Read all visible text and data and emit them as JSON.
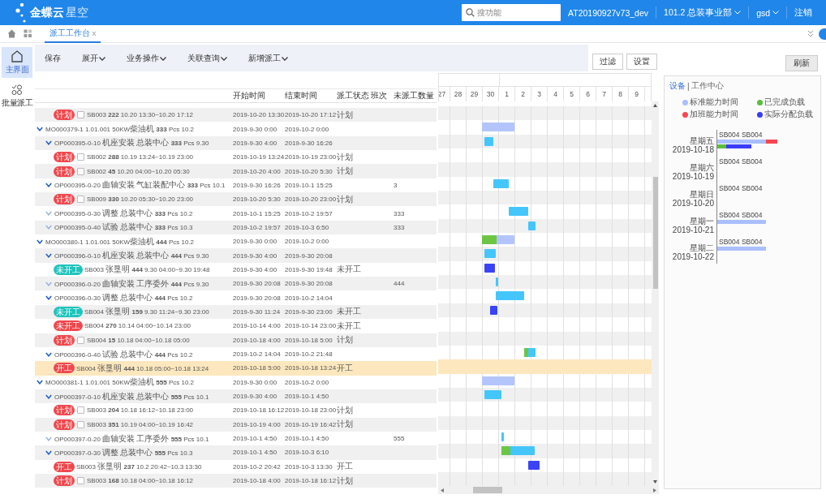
{
  "topbar": {
    "logo": {
      "name": "金蝶云",
      "product": "星空"
    },
    "search": {
      "placeholder": "搜功能"
    },
    "account": "AT20190927v73_dev",
    "org": "101.2 总装事业部",
    "user": "gsd",
    "logout": "注销"
  },
  "tabs": [
    {
      "label": "派工工作台",
      "close": "x",
      "selected": true
    }
  ],
  "sidebar": {
    "items": [
      {
        "kind": "home",
        "label": "主界面",
        "selected": true
      },
      {
        "kind": "batch",
        "label": "批量派工",
        "selected": false
      }
    ]
  },
  "toolbar": [
    {
      "label": "保存",
      "dropdown": false
    },
    {
      "label": "展开",
      "dropdown": true
    },
    {
      "label": "业务操作",
      "dropdown": true
    },
    {
      "label": "关联查询",
      "dropdown": true
    },
    {
      "label": "新增派工",
      "dropdown": true
    }
  ],
  "gantt_buttons": [
    "过滤",
    "设置"
  ],
  "refresh": "刷新",
  "table": {
    "columns": [
      "开始时间",
      "结束时间",
      "派工状态",
      "班次",
      "未派工数量"
    ],
    "rows": [
      {
        "kind": "task",
        "badge": {
          "text": "计划",
          "color": "#f0474d"
        },
        "checked": false,
        "text": "SB003 **222** 10.20 13:30~10.20 17:12",
        "start": "2019-10-20 13:30",
        "end": "2019-10-20 17:12",
        "status": "计划",
        "selected": false
      },
      {
        "kind": "mo",
        "expanded": true,
        "text": "MO000379-1 1.01.001 50KW柴油机 **333** Pcs 10.2",
        "start": "2019-9-30 0:00",
        "end": "2019-10-2 0:00",
        "selected": false,
        "children": [
          {
            "kind": "op",
            "expanded": true,
            "text": "OP000395-0-10 机座安装 总装中心 **333** Pcs 9.30",
            "start": "2019-9-30 4:00",
            "end": "2019-9-30 16:26",
            "selected": false,
            "children": [
              {
                "kind": "task",
                "badge": {
                  "text": "计划",
                  "color": "#f0474d"
                },
                "checked": false,
                "text": "SB002 **288** 10.19 13:24~10.19 23:00",
                "start": "2019-10-19 13:24",
                "end": "2019-10-19 23:00",
                "status": "计划",
                "selected": false
              },
              {
                "kind": "task",
                "badge": {
                  "text": "计划",
                  "color": "#f0474d"
                },
                "checked": false,
                "text": "SB002 **45** 10.20 04:00~10.20 05:30",
                "start": "2019-10-20 4:00",
                "end": "2019-10-20 5:30",
                "status": "计划",
                "selected": false
              }
            ]
          },
          {
            "kind": "op",
            "expanded": true,
            "text": "OP000395-0-20 曲轴安装 气缸装配中心 **333** Pcs 10.1",
            "start": "2019-9-30 16:26",
            "end": "2019-10-1 15:25",
            "unassigned": "3",
            "selected": false,
            "children": [
              {
                "kind": "task",
                "badge": {
                  "text": "计划",
                  "color": "#f0474d"
                },
                "checked": false,
                "text": "SB009 **330** 10.20 05:30~10.20 23:00",
                "start": "2019-10-20 5:30",
                "end": "2019-10-20 23:00",
                "status": "计划",
                "selected": false
              }
            ]
          },
          {
            "kind": "op",
            "expanded": false,
            "text": "OP000395-0-30 调整 总装中心 **333** Pcs 10.2",
            "start": "2019-10-1 15:25",
            "end": "2019-10-2 19:57",
            "unassigned": "333",
            "selected": false
          },
          {
            "kind": "op",
            "expanded": false,
            "text": "OP000395-0-40 试验 总装中心 **333** Pcs 10.3",
            "start": "2019-10-2 19:57",
            "end": "2019-10-3 6:50",
            "unassigned": "333",
            "selected": false
          }
        ]
      },
      {
        "kind": "mo",
        "expanded": true,
        "text": "MO000380-1 1.01.001 50KW柴油机 **444** Pcs 10.2",
        "start": "2019-9-30 0:00",
        "end": "2019-10-2 0:00",
        "level": 0.46,
        "selected": false,
        "children": [
          {
            "kind": "op",
            "expanded": true,
            "text": "OP000396-0-10 机座安装 总装中心 **444** Pcs 9.30",
            "start": "2019-9-30 4:00",
            "end": "2019-9-30 20:08",
            "selected": false,
            "children": [
              {
                "kind": "task",
                "badge": {
                  "text": "未开工",
                  "color": "#1fc3bc"
                },
                "text": "SB003 张垦明 **444** 9.30 04:00~9.30 19:48",
                "start": "2019-9-30 4:00",
                "end": "2019-9-30 19:48",
                "status": "未开工",
                "selected": false
              }
            ]
          },
          {
            "kind": "op",
            "expanded": false,
            "text": "OP000396-0-20 曲轴安装 工序委外 **444** Pcs 9.30",
            "start": "2019-9-30 20:08",
            "end": "2019-9-30 20:08",
            "unassigned": "444",
            "selected": false
          },
          {
            "kind": "op",
            "expanded": true,
            "text": "OP000396-0-30 调整 总装中心 **444** Pcs 10.2",
            "start": "2019-9-30 20:08",
            "end": "2019-10-2 14:04",
            "selected": false,
            "children": [
              {
                "kind": "task",
                "badge": {
                  "text": "未开工",
                  "color": "#1fc3bc"
                },
                "text": "SB004 张垦明 **159** 9.30 11:24~9.30 23:00",
                "start": "2019-9-30 11:24",
                "end": "2019-9-30 23:00",
                "status": "未开工",
                "selected": false
              },
              {
                "kind": "task",
                "badge": {
                  "text": "未开工",
                  "color": "#f0474d"
                },
                "text": "SB004 **270** 10.14 04:00~10.14 23:00",
                "start": "2019-10-14 4:00",
                "end": "2019-10-14 23:00",
                "status": "未开工",
                "selected": false
              },
              {
                "kind": "task",
                "badge": {
                  "text": "计划",
                  "color": "#f0474d"
                },
                "checked": false,
                "text": "SB004 **15** 10.18 04:00~10.18 05:00",
                "start": "2019-10-18 4:00",
                "end": "2019-10-18 5:00",
                "status": "计划",
                "selected": false
              }
            ]
          },
          {
            "kind": "op",
            "expanded": true,
            "text": "OP000396-0-40 试验 总装中心 **444** Pcs 10.2",
            "start": "2019-10-2 14:04",
            "end": "2019-10-2 21:48",
            "level": 0.4,
            "selected": false,
            "children": [
              {
                "kind": "task",
                "badge": {
                  "text": "开工",
                  "color": "#f0474d"
                },
                "text": "SB004 张垦明 **444** 10.18 05:00~10.18 13:24",
                "start": "2019-10-18 5:00",
                "end": "2019-10-18 13:24",
                "status": "开工",
                "selected": true
              }
            ]
          }
        ]
      },
      {
        "kind": "mo",
        "expanded": true,
        "text": "MO000381-1 1.01.001 50KW柴油机 **555** Pcs 10.2",
        "start": "2019-9-30 0:00",
        "end": "2019-10-2 0:00",
        "selected": false,
        "children": [
          {
            "kind": "op",
            "expanded": true,
            "text": "OP000397-0-10 机座安装 总装中心 **555** Pcs 10.1",
            "start": "2019-9-30 4:00",
            "end": "2019-10-1 4:50",
            "selected": false,
            "children": [
              {
                "kind": "task",
                "badge": {
                  "text": "计划",
                  "color": "#f0474d"
                },
                "checked": false,
                "text": "SB003 **204** 10.18 16:12~10.18 23:00",
                "start": "2019-10-18 16:12",
                "end": "2019-10-18 23:00",
                "status": "计划",
                "selected": false
              },
              {
                "kind": "task",
                "badge": {
                  "text": "计划",
                  "color": "#f0474d"
                },
                "checked": false,
                "text": "SB003 **351** 10.19 04:00~10.19 16:42",
                "start": "2019-10-19 4:00",
                "end": "2019-10-19 16:42",
                "status": "计划",
                "selected": false
              }
            ]
          },
          {
            "kind": "op",
            "expanded": false,
            "text": "OP000397-0-20 曲轴安装 工序委外 **555** Pcs 10.1",
            "start": "2019-10-1 4:50",
            "end": "2019-10-1 4:50",
            "unassigned": "555",
            "selected": false
          },
          {
            "kind": "op",
            "expanded": true,
            "text": "OP000397-0-30 调整 总装中心 **555** Pcs 10.3",
            "start": "2019-10-1 4:50",
            "end": "2019-10-3 6:10",
            "level": 0.27,
            "selected": false,
            "children": [
              {
                "kind": "task",
                "badge": {
                  "text": "开工",
                  "color": "#f0474d"
                },
                "text": "SB003 张垦明 **237** 10.2 20:42~10.3 13:30",
                "start": "2019-10-2 20:42",
                "end": "2019-10-3 13:30",
                "status": "开工",
                "selected": false
              },
              {
                "kind": "task",
                "badge": {
                  "text": "计划",
                  "color": "#f0474d"
                },
                "checked": false,
                "text": "SB003 **168** 10.18 04:00~10.18 16:12",
                "start": "2019-10-18 4:00",
                "end": "2019-10-18 16:12",
                "status": "计划",
                "selected": false
              }
            ]
          }
        ]
      }
    ]
  },
  "gantt": {
    "days": [
      "27",
      "28",
      "29",
      "30",
      "1",
      "2",
      "3",
      "4",
      "5",
      "6",
      "7",
      "8",
      "9"
    ]
  },
  "panel": {
    "tabs": [
      {
        "label": "设备",
        "selected": true
      },
      {
        "label": "工作中心",
        "selected": false
      }
    ],
    "separator": "|",
    "legend": [
      {
        "label": "标准能力时间",
        "color": "#aabfff"
      },
      {
        "label": "已完成负载",
        "color": "#5cbf3b"
      },
      {
        "label": "加班能力时间",
        "color": "#f5474f"
      },
      {
        "label": "实际分配负载",
        "color": "#3a3df5"
      }
    ],
    "days": [
      {
        "weekday": "星期五",
        "date": "2019-10-18",
        "devices": "SB004 SB004"
      },
      {
        "weekday": "星期六",
        "date": "2019-10-19",
        "devices": "SB004 SB004"
      },
      {
        "weekday": "星期日",
        "date": "2019-10-20",
        "devices": "SB004 SB004"
      },
      {
        "weekday": "星期一",
        "date": "2019-10-21",
        "devices": "SB004 SB004"
      },
      {
        "weekday": "星期二",
        "date": "2019-10-22",
        "devices": "SB004 SB004"
      }
    ]
  }
}
